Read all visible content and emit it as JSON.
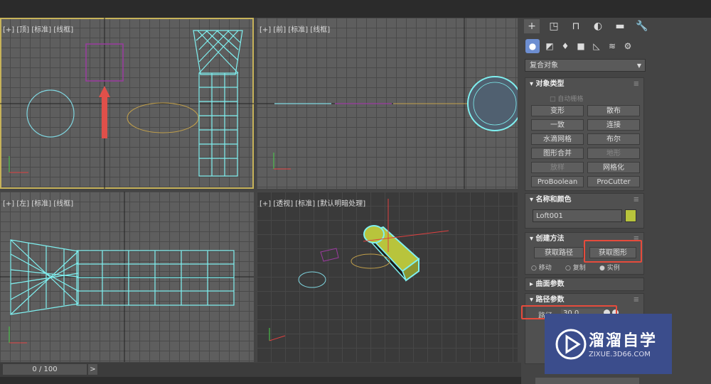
{
  "viewports": {
    "top": "[+] [顶] [标准] [线框]",
    "front": "[+] [前] [标准] [线框]",
    "left": "[+] [左] [标准] [线框]",
    "perspective": "[+] [透视] [标准] [默认明暗处理]"
  },
  "command_panel": {
    "tabs": [
      "create-icon",
      "modify-icon",
      "hierarchy-icon",
      "motion-icon",
      "display-icon",
      "utilities-icon"
    ],
    "category_dropdown": "复合对象",
    "object_type": {
      "title": "对象类型",
      "autogrid": "自动栅格",
      "buttons": [
        "变形",
        "散布",
        "一致",
        "连接",
        "水滴网格",
        "布尔",
        "图形合并",
        "地形",
        "放样",
        "网格化",
        "ProBoolean",
        "ProCutter"
      ]
    },
    "name_color": {
      "title": "名称和颜色",
      "name_value": "Loft001",
      "color": "#b8c43c"
    },
    "creation_method": {
      "title": "创建方法",
      "get_path": "获取路径",
      "get_shape": "获取图形",
      "move": "移动",
      "copy": "复制",
      "instance": "实例"
    },
    "surface_params": "曲面参数",
    "path_params": {
      "title": "路径参数",
      "path_label": "路径:",
      "path_value": "30.0"
    }
  },
  "timeline": {
    "frame": "0 / 100",
    "next": ">"
  },
  "watermark": {
    "title": "溜溜自学",
    "url": "ZIXUE.3D66.COM"
  },
  "colors": {
    "highlight": "#e64b3c",
    "wire": "#7ff0f0",
    "active_viewport": "#c7b35a"
  }
}
